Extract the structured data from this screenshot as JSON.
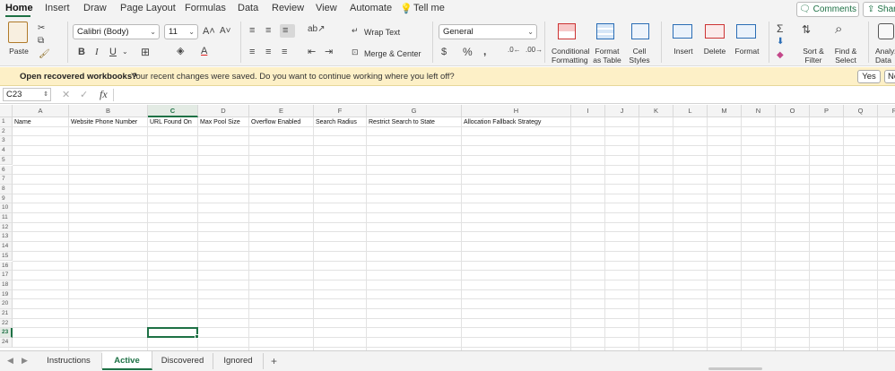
{
  "menu": {
    "tabs": [
      "Home",
      "Insert",
      "Draw",
      "Page Layout",
      "Formulas",
      "Data",
      "Review",
      "View",
      "Automate"
    ],
    "tell_me": "Tell me",
    "comments": "Comments",
    "share": "Share"
  },
  "ribbon": {
    "paste": "Paste",
    "font_name": "Calibri (Body)",
    "font_size": "11",
    "wrap_text": "Wrap Text",
    "merge_center": "Merge & Center",
    "number_format": "General",
    "conditional_formatting": [
      "Conditional",
      "Formatting"
    ],
    "format_as_table": [
      "Format",
      "as Table"
    ],
    "cell_styles": [
      "Cell",
      "Styles"
    ],
    "insert": "Insert",
    "delete": "Delete",
    "format": "Format",
    "sort_filter": [
      "Sort &",
      "Filter"
    ],
    "find_select": [
      "Find &",
      "Select"
    ],
    "analyze_data": [
      "Analyze",
      "Data"
    ]
  },
  "notification": {
    "title": "Open recovered workbooks?",
    "message": "Your recent changes were saved. Do you want to continue working where you left off?",
    "yes": "Yes",
    "no": "No"
  },
  "formula_bar": {
    "name_box": "C23",
    "fx": "fx"
  },
  "grid": {
    "columns": [
      "A",
      "B",
      "C",
      "D",
      "E",
      "F",
      "G",
      "H",
      "I",
      "J",
      "K",
      "L",
      "M",
      "N",
      "O",
      "P",
      "Q",
      "R"
    ],
    "rows": [
      "1",
      "2",
      "3",
      "4",
      "5",
      "6",
      "7",
      "8",
      "9",
      "10",
      "11",
      "12",
      "13",
      "14",
      "15",
      "16",
      "17",
      "18",
      "19",
      "20",
      "21",
      "22",
      "23",
      "24"
    ],
    "headers": [
      "Name",
      "Website Phone Number",
      "URL Found On",
      "Max Pool Size",
      "Overflow Enabled",
      "Search Radius",
      "Restrict Search to State",
      "Allocation Fallback Strategy"
    ],
    "selected_cell": "C23"
  },
  "sheets": {
    "tabs": [
      "Instructions",
      "Active",
      "Discovered",
      "Ignored"
    ],
    "active": "Active",
    "add": "+"
  }
}
